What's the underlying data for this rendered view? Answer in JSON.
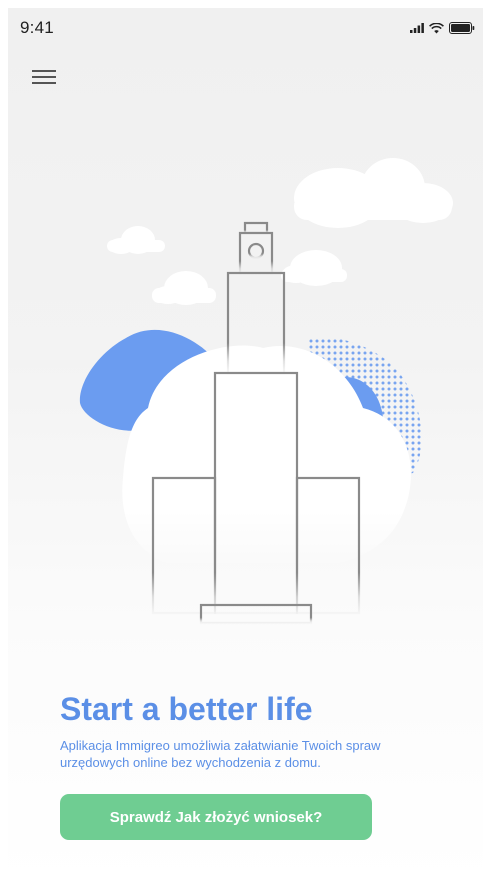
{
  "status_bar": {
    "time": "9:41",
    "icons": [
      "signal-icon",
      "wifi-icon",
      "battery-icon"
    ]
  },
  "header": {
    "menu_icon": "hamburger-menu-icon"
  },
  "hero": {
    "title": "Start a better life",
    "description": "Aplikacja Immigreo umożliwia załatwianie Twoich spraw urzędowych online bez wychodzenia z domu.",
    "cta_label": "Sprawdź Jak złożyć wniosek?"
  },
  "colors": {
    "accent_blue": "#5b8fe6",
    "button_green": "#6fcd92",
    "illustration_blue": "#6b9cf0",
    "outline_gray": "#8a8a8a",
    "background": "#f0f0f0"
  }
}
